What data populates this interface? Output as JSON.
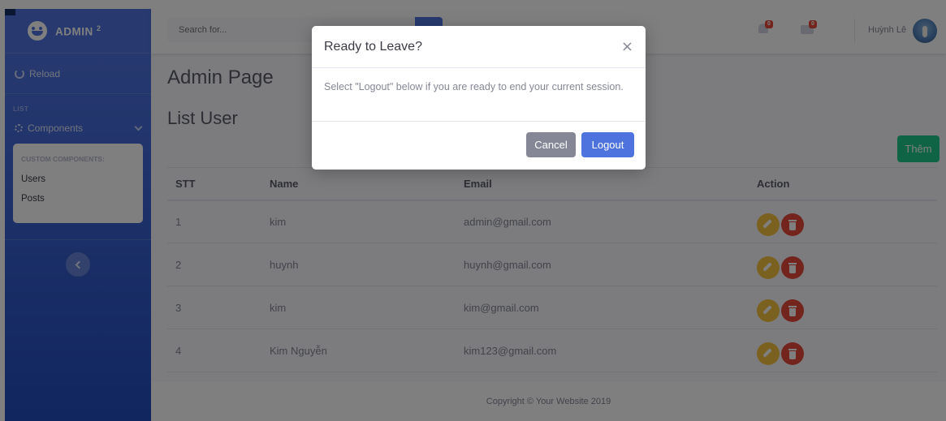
{
  "sidebar": {
    "brand": "ADMIN",
    "brand_sup": "2",
    "reload_label": "Reload",
    "heading_list": "LIST",
    "components_label": "Components",
    "collapse_heading": "CUSTOM COMPONENTS:",
    "collapse_items": [
      "Users",
      "Posts"
    ]
  },
  "topbar": {
    "search_placeholder": "Search for...",
    "alerts_badge": "0",
    "messages_badge": "0",
    "user_name": "Huỳnh Lê"
  },
  "main": {
    "page_title": "Admin Page",
    "list_title": "List User",
    "add_button": "Thêm",
    "table": {
      "headers": [
        "STT",
        "Name",
        "Email",
        "Action"
      ],
      "rows": [
        {
          "stt": "1",
          "name": "kim",
          "email": "admin@gmail.com"
        },
        {
          "stt": "2",
          "name": "huynh",
          "email": "huynh@gmail.com"
        },
        {
          "stt": "3",
          "name": "kim",
          "email": "kim@gmail.com"
        },
        {
          "stt": "4",
          "name": "Kim Nguyễn",
          "email": "kim123@gmail.com"
        }
      ]
    }
  },
  "footer": {
    "copyright": "Copyright © Your Website 2019"
  },
  "modal": {
    "title": "Ready to Leave?",
    "close": "×",
    "body": "Select \"Logout\" below if you are ready to end your current session.",
    "cancel_label": "Cancel",
    "logout_label": "Logout"
  },
  "colors": {
    "primary": "#4e73df",
    "success": "#1cc88a",
    "warning": "#f6c23e",
    "danger": "#e74a3b",
    "secondary": "#858796"
  },
  "icons": [
    "brand-laugh-icon",
    "refresh-icon",
    "gear-icon",
    "chevron-down-icon",
    "chevron-left-icon",
    "search-icon",
    "bell-icon",
    "envelope-icon",
    "pencil-icon",
    "trash-icon",
    "close-icon"
  ]
}
